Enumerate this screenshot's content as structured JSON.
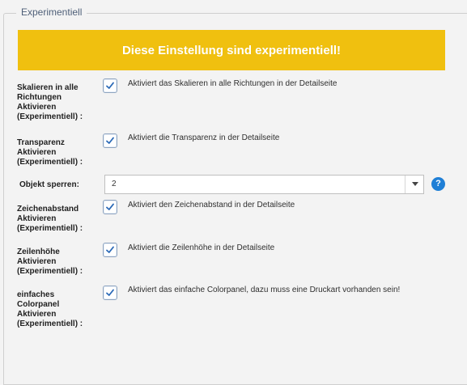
{
  "section": {
    "legend": "Experimentiell"
  },
  "warning_banner": "Diese Einstellung sind experimentiell!",
  "settings": [
    {
      "label": "Skalieren in alle\nRichtungen\nAktivieren\n(Experimentiell) :",
      "description": "Aktiviert das Skalieren in alle Richtungen in der Detailseite",
      "checked": true
    },
    {
      "label": "Transparenz\nAktivieren\n(Experimentiell) :",
      "description": "Aktiviert die Transparenz in der Detailseite",
      "checked": true
    },
    {
      "label": "Objekt sperren:",
      "value": "2"
    },
    {
      "label": "Zeichenabstand\nAktivieren\n(Experimentiell) :",
      "description": "Aktiviert den Zeichenabstand in der Detailseite",
      "checked": true
    },
    {
      "label": "Zeilenhöhe\nAktivieren\n(Experimentiell) :",
      "description": "Aktiviert die Zeilenhöhe in der Detailseite",
      "checked": true
    },
    {
      "label": "einfaches\nColorpanel\nAktivieren\n(Experimentiell) :",
      "description": "Aktiviert das einfache Colorpanel, dazu muss eine Druckart vorhanden sein!",
      "checked": true
    }
  ],
  "help_icon": {
    "name": "help-icon",
    "symbol": "?"
  },
  "colors": {
    "banner": "#f0c00f",
    "checkbox_border": "#8fa4bf",
    "check": "#2a69b7",
    "help": "#1f7fd6"
  }
}
